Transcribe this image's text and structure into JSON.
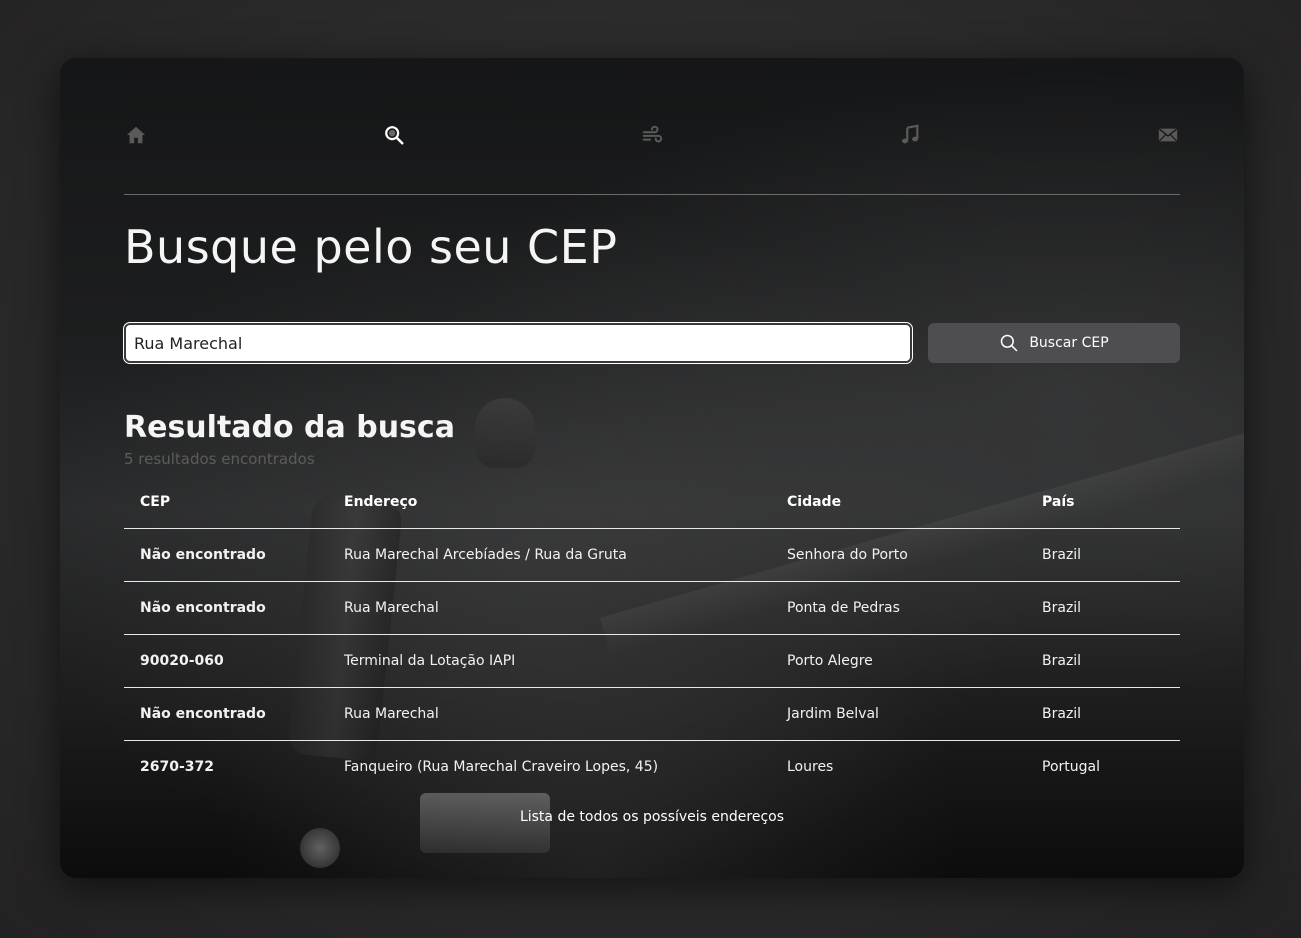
{
  "nav": {
    "items": [
      {
        "name": "home",
        "icon": "home-icon",
        "active": false
      },
      {
        "name": "search",
        "icon": "search-icon",
        "active": true
      },
      {
        "name": "weather",
        "icon": "wind-icon",
        "active": false
      },
      {
        "name": "music",
        "icon": "music-icon",
        "active": false
      },
      {
        "name": "contact",
        "icon": "envelope-icon",
        "active": false
      }
    ]
  },
  "header": {
    "title": "Busque pelo seu CEP"
  },
  "search": {
    "value": "Rua Marechal",
    "button_label": "Buscar CEP",
    "button_icon": "search-icon"
  },
  "results": {
    "title": "Resultado da busca",
    "subtitle": "5 resultados encontrados",
    "columns": [
      "CEP",
      "Endereço",
      "Cidade",
      "País"
    ],
    "rows": [
      {
        "cep": "Não encontrado",
        "endereco": "Rua Marechal Arcebíades / Rua da Gruta",
        "cidade": "Senhora do Porto",
        "pais": "Brazil"
      },
      {
        "cep": "Não encontrado",
        "endereco": "Rua Marechal",
        "cidade": "Ponta de Pedras",
        "pais": "Brazil"
      },
      {
        "cep": "90020-060",
        "endereco": "Terminal da Lotação IAPI",
        "cidade": "Porto Alegre",
        "pais": "Brazil"
      },
      {
        "cep": "Não encontrado",
        "endereco": "Rua Marechal",
        "cidade": "Jardim Belval",
        "pais": "Brazil"
      },
      {
        "cep": "2670-372",
        "endereco": "Fanqueiro (Rua Marechal Craveiro Lopes, 45)",
        "cidade": "Loures",
        "pais": "Portugal"
      }
    ],
    "caption": "Lista de todos os possíveis endereços"
  },
  "colors": {
    "nav_inactive": "#5a5a5a",
    "nav_active": "#ffffff",
    "button_bg": "#4d4d52",
    "subtitle": "#5c5c5c"
  }
}
